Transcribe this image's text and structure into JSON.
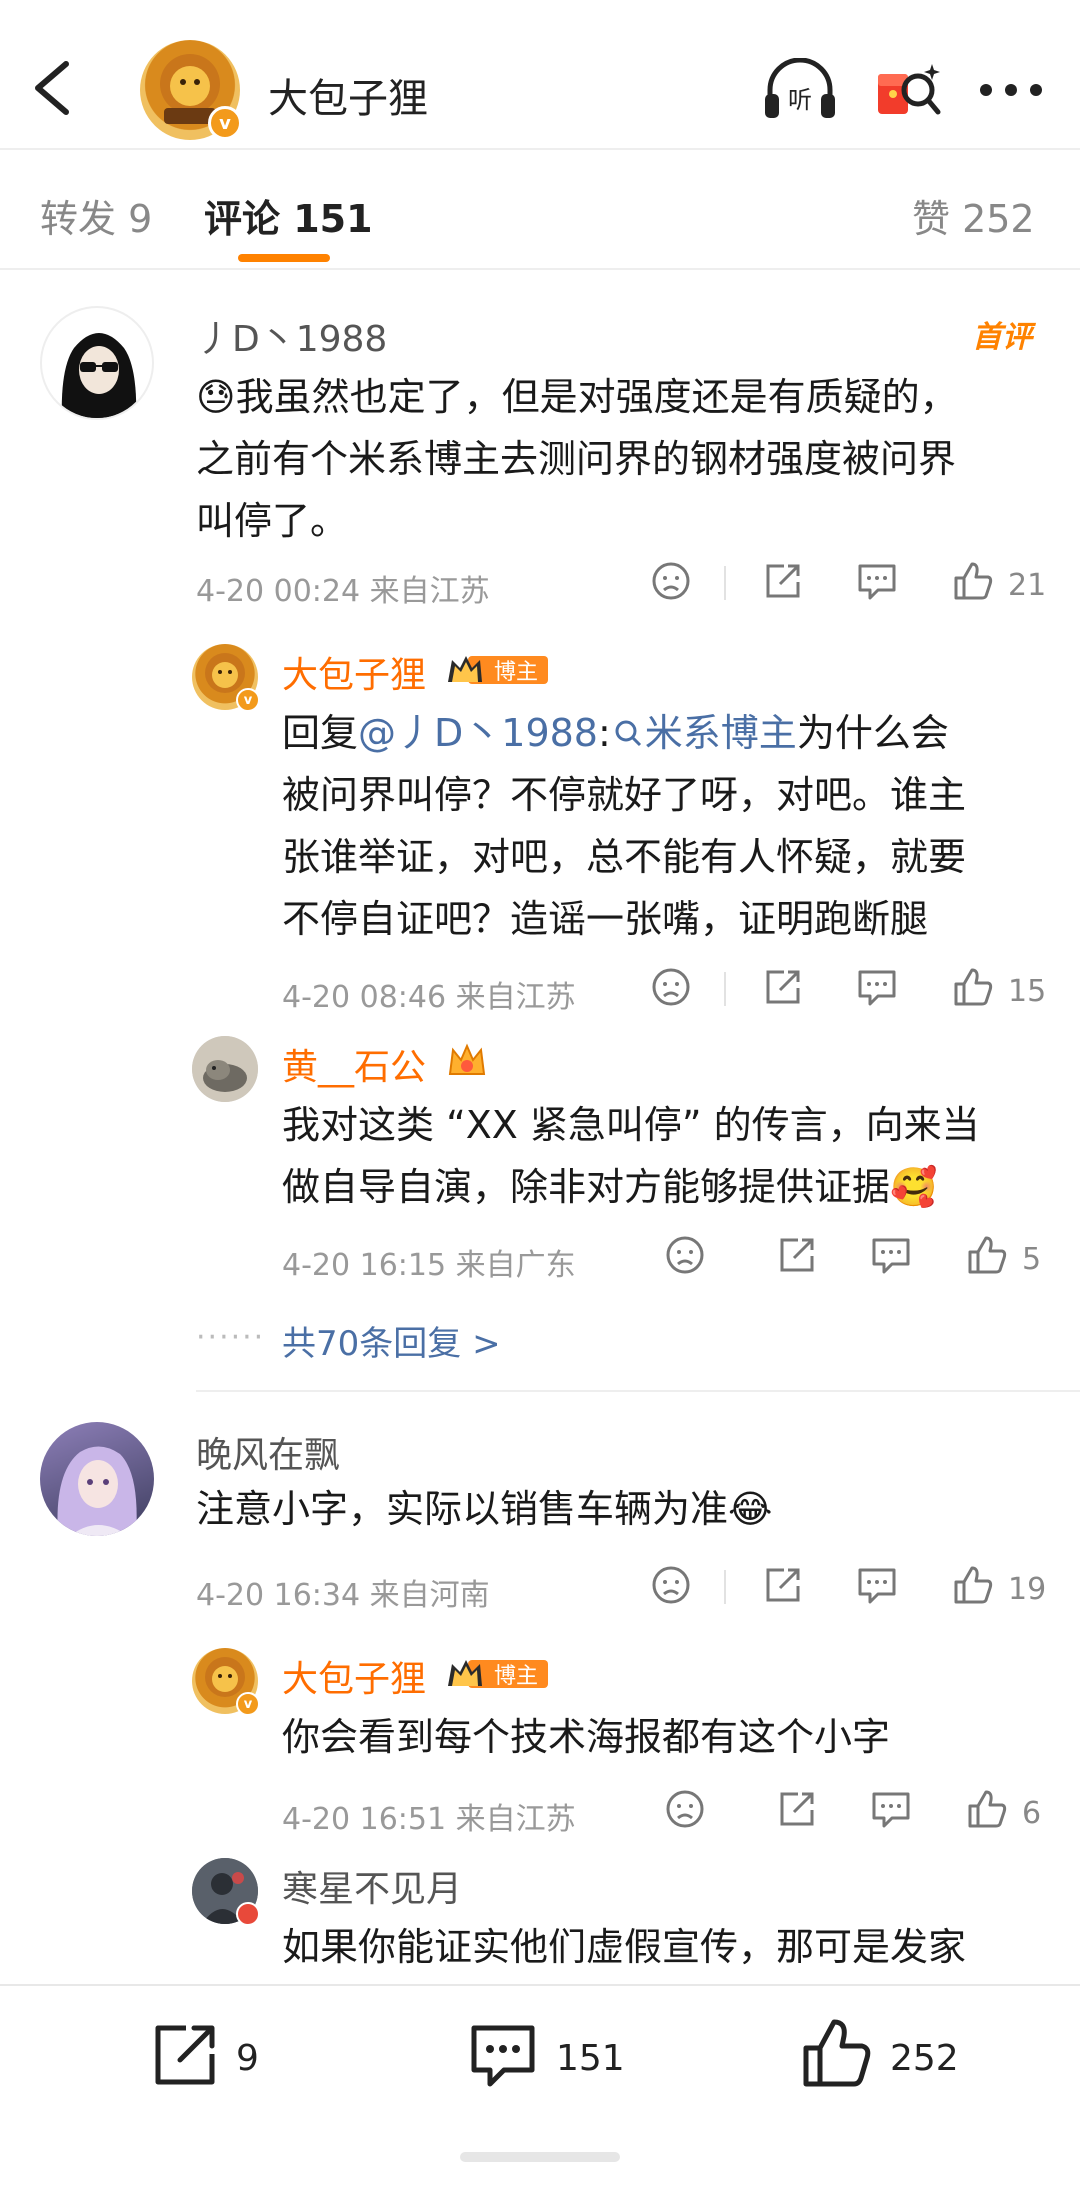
{
  "header": {
    "author": "大包子狸",
    "avatar_badge": "v"
  },
  "tabs": {
    "repost": "转发 9",
    "comments": "评论 151",
    "likes": "赞 252"
  },
  "comments": [
    {
      "name": "丿D丶1988",
      "tag": "首评",
      "emoji": "😓",
      "text_lines": [
        "我虽然也定了，但是对强度还是有质疑的，",
        "之前有个米系博主去测问界的钢材强度被问界",
        "叫停了。"
      ],
      "meta": "4-20 00:24  来自江苏",
      "likes": "21",
      "replies": [
        {
          "name": "大包子狸",
          "badge": "博主",
          "reply_prefix": "回复",
          "mention": "@丿D丶1988",
          "colon": ":",
          "topic": "米系博主",
          "text_lines_first": "为什么会",
          "text_lines": [
            "被问界叫停？不停就好了呀，对吧。谁主",
            "张谁举证，对吧，总不能有人怀疑，就要",
            "不停自证吧？造谣一张嘴，证明跑断腿"
          ],
          "meta": "4-20 08:46  来自江苏",
          "likes": "15"
        },
        {
          "name": "黄__石公",
          "text_lines": [
            "我对这类 “XX 紧急叫停” 的传言，向来当",
            "做自导自演，除非对方能够提供证据"
          ],
          "emoji": "🥰",
          "meta": "4-20 16:15  来自广东",
          "likes": "5"
        }
      ],
      "more_replies": "共70条回复 >"
    },
    {
      "name": "晚风在飘",
      "text": "注意小字，实际以销售车辆为准",
      "emoji": "😂",
      "meta": "4-20 16:34  来自河南",
      "likes": "19",
      "replies": [
        {
          "name": "大包子狸",
          "badge": "博主",
          "text": "你会看到每个技术海报都有这个小字",
          "meta": "4-20 16:51  来自江苏",
          "likes": "6"
        },
        {
          "name": "寒星不见月",
          "text": "如果你能证实他们虚假宣传，那可是发家"
        }
      ]
    }
  ],
  "bottom": {
    "repost_count": "9",
    "comment_count": "151",
    "like_count": "252"
  },
  "colors": {
    "accent": "#ff8200",
    "name_orange": "#ff6d00",
    "link": "#4a6fa5"
  }
}
